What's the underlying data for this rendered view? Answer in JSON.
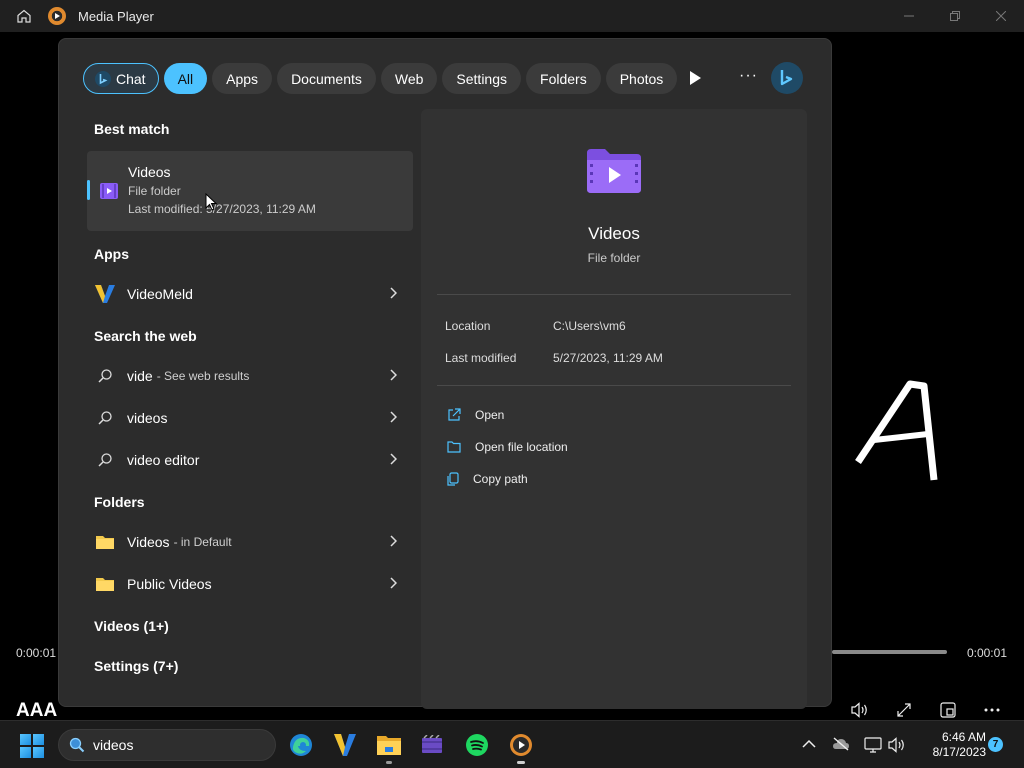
{
  "titlebar": {
    "title": "Media Player"
  },
  "player": {
    "current_time": "0:00:01",
    "total_time": "0:00:01",
    "media_title": "AAA",
    "video_frame_text": "A"
  },
  "search": {
    "chips": {
      "chat": "Chat",
      "all": "All",
      "apps": "Apps",
      "documents": "Documents",
      "web": "Web",
      "settings": "Settings",
      "folders": "Folders",
      "photos": "Photos"
    },
    "more": "···",
    "sections": {
      "best_match": "Best match",
      "apps": "Apps",
      "search_web": "Search the web",
      "folders": "Folders",
      "videos_more": "Videos (1+)",
      "settings_more": "Settings (7+)"
    },
    "best_match": {
      "name": "Videos",
      "type": "File folder",
      "modified": "Last modified: 5/27/2023, 11:29 AM"
    },
    "apps": [
      {
        "name": "VideoMeld"
      }
    ],
    "web": [
      {
        "query": "vide",
        "suffix": "- See web results"
      },
      {
        "query": "videos",
        "suffix": ""
      },
      {
        "query": "video editor",
        "suffix": ""
      }
    ],
    "folders": [
      {
        "name": "Videos",
        "suffix": "- in Default"
      },
      {
        "name": "Public Videos",
        "suffix": ""
      }
    ],
    "preview": {
      "title": "Videos",
      "subtitle": "File folder",
      "location_label": "Location",
      "location_value": "C:\\Users\\vm6",
      "modified_label": "Last modified",
      "modified_value": "5/27/2023, 11:29 AM",
      "actions": {
        "open": "Open",
        "open_location": "Open file location",
        "copy_path": "Copy path"
      }
    }
  },
  "taskbar": {
    "search_query": "videos",
    "time": "6:46 AM",
    "date": "8/17/2023",
    "notification_count": "7"
  },
  "colors": {
    "accent": "#4cc2ff",
    "folder_purple": "#8a5cf6",
    "folder_yellow": "#f2c94c"
  }
}
